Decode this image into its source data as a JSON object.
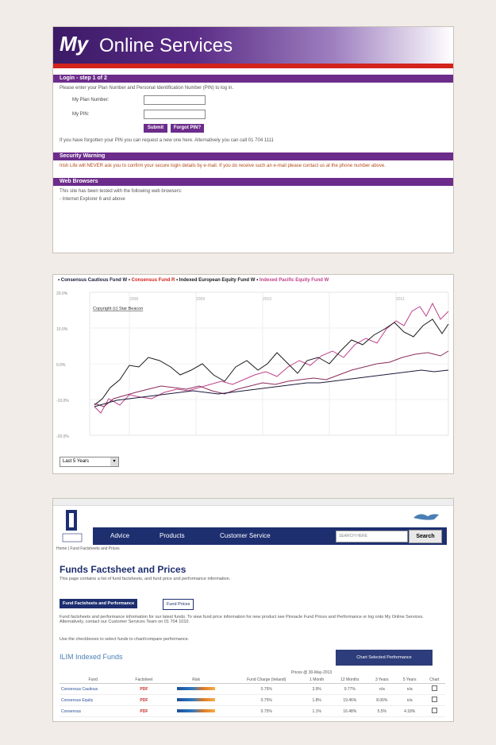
{
  "panel1": {
    "banner_my": "My",
    "banner_title": "Online Services",
    "login_header": "Login - step 1 of 2",
    "login_intro": "Please enter your Plan Number and Personal Identification Number (PIN) to log in.",
    "plan_label": "My Plan Number:",
    "pin_label": "My PIN:",
    "submit_label": "Submit",
    "forgot_label": "Forgot PIN?",
    "forgot_text": "If you have forgotten your PIN you can request a new one here. Alternatively you can call 01 704 1111",
    "security_header": "Security Warning",
    "security_text": "Irish Life will NEVER ask you to confirm your secure login details by e-mail. If you do receive such an e-mail please contact us at the phone number above.",
    "browsers_header": "Web Browsers",
    "browsers_text": "This site has been tested with the following web browsers:",
    "browser_item": "- Internet Explorer 6 and above",
    "colors": {
      "purple": "#6c2c8b",
      "red": "#d2231c"
    }
  },
  "panel2": {
    "legend": [
      {
        "name": "Consensus Cautious Fund W",
        "color": "#1a1a3a"
      },
      {
        "name": "Consensus Fund R",
        "color": "#d2231c"
      },
      {
        "name": "Indexed European Equity Fund W",
        "color": "#1a1a1a"
      },
      {
        "name": "Indexed Pacific Equity Fund W",
        "color": "#c0408a"
      }
    ],
    "copyright": "Copyright (c) Star Beacon",
    "y_ticks": [
      "20.0%",
      "10.0%",
      "0.0%",
      "-10.0%",
      "-20.0%"
    ],
    "year_ticks": [
      "2008",
      "2009",
      "2010",
      "2011"
    ],
    "period_select": "Last 5 Years",
    "period_chevron": "▾"
  },
  "panel3": {
    "nav": {
      "advice": "Advice",
      "products": "Products",
      "customer": "Customer Service"
    },
    "search_placeholder": "SEARCH HERE",
    "search_button": "Search",
    "breadcrumb": "Home | Fund Factsheets and Prices",
    "title": "Funds Factsheet and Prices",
    "subtitle": "This page contains a list of fund factsheets, and fund price and performance information.",
    "tab_active": "Fund Factsheets and Performance",
    "tab_other": "Fund Prices",
    "body1": "Fund factsheets and performance information for our latest funds. To view fund price information for new product see Pinnacle Fund Prices and Performance or log onto My Online Services. Alternatively, contact our Customer Services Team on 01 704 1010.",
    "body2": "Use the checkboxes to select funds to chart/compare performance.",
    "section_title": "ILIM Indexed Funds",
    "perf_button": "Chart Selected Performance",
    "price_date": "Prices @ 30-May-2013",
    "columns": [
      "Fund",
      "Factsheet",
      "Risk",
      "Fund Charge (Ireland)",
      "1 Month",
      "12 Months",
      "3 Years",
      "5 Years",
      "Chart"
    ],
    "rows": [
      {
        "fund": "Consensus Cautious",
        "factsheet": "PDF",
        "charge": "0.75%",
        "m1": "3.9%",
        "m12": "9.77%",
        "y3": "n/a",
        "y5": "n/a"
      },
      {
        "fund": "Consensus Equity",
        "factsheet": "PDF",
        "charge": "0.75%",
        "m1": "1.8%",
        "m12": "19.46%",
        "y3": "8.06%",
        "y5": "n/a"
      },
      {
        "fund": "Consensus",
        "factsheet": "PDF",
        "charge": "0.75%",
        "m1": "1.1%",
        "m12": "16.48%",
        "y3": "5.5%",
        "y5": "4.18%"
      }
    ]
  }
}
